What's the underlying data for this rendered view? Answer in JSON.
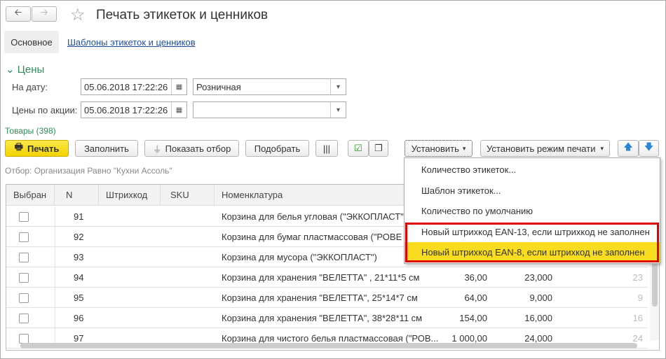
{
  "window": {
    "title": "Печать этикеток и ценников"
  },
  "tabs": {
    "main": "Основное",
    "templates": "Шаблоны этикеток и ценников"
  },
  "prices": {
    "section": "Цены",
    "date_label": "На дату:",
    "date_value": "05.06.2018 17:22:26",
    "price_type": "Розничная",
    "promo_label": "Цены по акции:",
    "promo_date": "05.06.2018 17:22:26",
    "promo_type": ""
  },
  "goods": {
    "title": "Товары (398)",
    "filter": "Отбор: Организация Равно \"Кухни Ассоль\""
  },
  "toolbar": {
    "print": "Печать",
    "fill": "Заполнить",
    "show_filter": "Показать отбор",
    "pick": "Подобрать",
    "set": "Установить",
    "set_print_mode": "Установить режим печати"
  },
  "menu": [
    "Количество этикеток...",
    "Шаблон этикеток...",
    "Количество по умолчанию",
    "Новый штрихкод EAN-13, если штрихкод не заполнен",
    "Новый штрихкод EAN-8, если штрихкод не заполнен"
  ],
  "columns": {
    "selected": "Выбран",
    "n": "N",
    "barcode": "Штрихкод",
    "sku": "SKU",
    "item": "Номенклатура"
  },
  "rows": [
    {
      "n": "91",
      "item": "Корзина для белья угловая (\"ЭККОПЛАСТ\")",
      "price": "",
      "qty": "",
      "count": ""
    },
    {
      "n": "92",
      "item": "Корзина для бумаг пластмассовая (\"РОВЕ",
      "price": "",
      "qty": "",
      "count": ""
    },
    {
      "n": "93",
      "item": "Корзина для мусора (\"ЭККОПЛАСТ\")",
      "price": "",
      "qty": "",
      "count": ""
    },
    {
      "n": "94",
      "item": "Корзина для хранения \"ВЕЛЕТТА\" , 21*11*5 см",
      "price": "36,00",
      "qty": "23,000",
      "count": "23"
    },
    {
      "n": "95",
      "item": "Корзина для хранения \"ВЕЛЕТТА\", 25*14*7 см",
      "price": "64,00",
      "qty": "9,000",
      "count": "9"
    },
    {
      "n": "96",
      "item": "Корзина для хранения \"ВЕЛЕТТА\", 38*28*11 см",
      "price": "154,00",
      "qty": "16,000",
      "count": "16"
    },
    {
      "n": "97",
      "item": "Корзина для чистого белья пластмассовая (\"РОВ...",
      "price": "1 000,00",
      "qty": "24,000",
      "count": "24"
    }
  ]
}
